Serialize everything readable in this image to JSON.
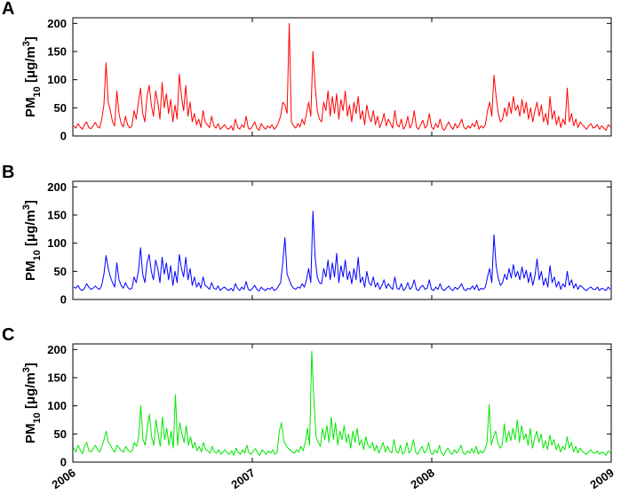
{
  "chart_data": [
    {
      "type": "line",
      "panel": "A",
      "color": "#ff0000",
      "ylabel": {
        "base": "PM",
        "sub": "10",
        "unit_pre": " [μg/m",
        "unit_sup": "3",
        "unit_post": "]"
      },
      "ylim": [
        0,
        210
      ],
      "yticks": [
        0,
        50,
        100,
        150,
        200
      ],
      "xlim": [
        "2006-01-01",
        "2009-01-01"
      ],
      "series": [
        {
          "values": [
            18,
            14,
            22,
            16,
            12,
            20,
            25,
            15,
            13,
            18,
            24,
            17,
            14,
            30,
            55,
            130,
            60,
            45,
            25,
            18,
            80,
            40,
            22,
            16,
            35,
            20,
            14,
            18,
            45,
            30,
            60,
            85,
            40,
            25,
            70,
            90,
            55,
            35,
            80,
            60,
            30,
            95,
            50,
            75,
            40,
            65,
            25,
            55,
            30,
            110,
            70,
            45,
            90,
            35,
            60,
            25,
            40,
            20,
            30,
            15,
            45,
            25,
            20,
            15,
            35,
            18,
            14,
            22,
            12,
            16,
            20,
            14,
            12,
            18,
            10,
            30,
            16,
            12,
            20,
            15,
            35,
            14,
            12,
            18,
            25,
            14,
            10,
            22,
            16,
            12,
            18,
            14,
            20,
            12,
            16,
            24,
            35,
            60,
            55,
            40,
            200,
            25,
            18,
            14,
            22,
            16,
            30,
            20,
            40,
            60,
            35,
            150,
            90,
            45,
            30,
            25,
            60,
            45,
            80,
            35,
            70,
            40,
            75,
            30,
            65,
            45,
            80,
            35,
            55,
            25,
            60,
            40,
            70,
            30,
            45,
            20,
            55,
            35,
            25,
            45,
            20,
            35,
            15,
            25,
            40,
            18,
            30,
            22,
            14,
            45,
            20,
            16,
            30,
            12,
            18,
            35,
            14,
            22,
            45,
            16,
            12,
            20,
            28,
            14,
            18,
            40,
            16,
            12,
            22,
            15,
            30,
            14,
            10,
            18,
            25,
            16,
            12,
            22,
            14,
            20,
            30,
            16,
            12,
            18,
            14,
            22,
            16,
            28,
            12,
            18,
            14,
            20,
            45,
            60,
            35,
            108,
            70,
            40,
            25,
            30,
            50,
            35,
            60,
            40,
            70,
            45,
            55,
            35,
            65,
            40,
            60,
            30,
            50,
            25,
            45,
            60,
            35,
            55,
            25,
            40,
            20,
            70,
            30,
            45,
            20,
            35,
            15,
            30,
            20,
            85,
            25,
            40,
            18,
            30,
            15,
            25,
            20,
            16,
            12,
            18,
            22,
            14,
            16,
            20,
            12,
            18,
            14,
            10,
            20,
            16
          ]
        }
      ]
    },
    {
      "type": "line",
      "panel": "B",
      "color": "#0000ff",
      "ylabel": {
        "base": "PM",
        "sub": "10",
        "unit_pre": " [μg/m",
        "unit_sup": "3",
        "unit_post": "]"
      },
      "ylim": [
        0,
        210
      ],
      "yticks": [
        0,
        50,
        100,
        150,
        200
      ],
      "xlim": [
        "2006-01-01",
        "2009-01-01"
      ],
      "series": [
        {
          "values": [
            22,
            20,
            25,
            18,
            16,
            20,
            28,
            22,
            18,
            20,
            24,
            20,
            18,
            25,
            45,
            78,
            55,
            40,
            30,
            22,
            65,
            35,
            25,
            20,
            30,
            22,
            18,
            20,
            40,
            30,
            50,
            92,
            45,
            30,
            65,
            80,
            50,
            35,
            70,
            55,
            30,
            75,
            45,
            65,
            35,
            60,
            25,
            50,
            30,
            80,
            55,
            40,
            75,
            35,
            55,
            25,
            40,
            22,
            30,
            20,
            40,
            25,
            22,
            18,
            30,
            20,
            18,
            24,
            16,
            20,
            22,
            18,
            16,
            20,
            15,
            28,
            20,
            16,
            22,
            18,
            32,
            18,
            16,
            20,
            25,
            18,
            15,
            22,
            18,
            16,
            20,
            18,
            22,
            16,
            18,
            24,
            30,
            65,
            110,
            45,
            35,
            25,
            20,
            18,
            22,
            20,
            28,
            22,
            35,
            55,
            30,
            157,
            75,
            40,
            30,
            28,
            55,
            40,
            70,
            35,
            65,
            40,
            82,
            30,
            60,
            40,
            70,
            35,
            50,
            28,
            55,
            35,
            75,
            30,
            40,
            22,
            50,
            30,
            25,
            40,
            22,
            30,
            18,
            25,
            35,
            20,
            28,
            22,
            18,
            40,
            20,
            18,
            28,
            16,
            20,
            30,
            18,
            22,
            35,
            18,
            16,
            22,
            25,
            18,
            20,
            35,
            18,
            16,
            22,
            18,
            28,
            18,
            16,
            20,
            24,
            18,
            16,
            22,
            18,
            22,
            28,
            18,
            16,
            20,
            18,
            24,
            18,
            26,
            16,
            20,
            18,
            22,
            40,
            55,
            30,
            115,
            60,
            38,
            25,
            30,
            45,
            35,
            55,
            38,
            62,
            40,
            50,
            35,
            58,
            38,
            52,
            30,
            48,
            25,
            42,
            72,
            35,
            50,
            25,
            38,
            22,
            60,
            30,
            40,
            22,
            32,
            18,
            28,
            22,
            50,
            25,
            35,
            20,
            28,
            18,
            25,
            22,
            18,
            16,
            20,
            22,
            18,
            18,
            22,
            16,
            20,
            18,
            16,
            22,
            18
          ]
        }
      ]
    },
    {
      "type": "line",
      "panel": "C",
      "color": "#00e600",
      "ylabel": {
        "base": "PM",
        "sub": "10",
        "unit_pre": " [μg/m",
        "unit_sup": "3",
        "unit_post": "]"
      },
      "ylim": [
        0,
        210
      ],
      "yticks": [
        0,
        50,
        100,
        150,
        200
      ],
      "xlim": [
        "2006-01-01",
        "2009-01-01"
      ],
      "xticks": [
        "2006",
        "2007",
        "2008",
        "2009"
      ],
      "series": [
        {
          "values": [
            25,
            18,
            30,
            22,
            15,
            28,
            35,
            20,
            18,
            24,
            30,
            22,
            18,
            28,
            40,
            55,
            35,
            30,
            22,
            18,
            30,
            25,
            20,
            18,
            28,
            22,
            18,
            20,
            35,
            28,
            45,
            100,
            40,
            30,
            60,
            85,
            45,
            30,
            75,
            50,
            28,
            80,
            40,
            60,
            30,
            55,
            25,
            120,
            30,
            70,
            50,
            35,
            65,
            30,
            45,
            25,
            35,
            20,
            28,
            18,
            35,
            22,
            20,
            16,
            28,
            18,
            16,
            22,
            14,
            18,
            22,
            16,
            14,
            20,
            12,
            25,
            18,
            14,
            22,
            16,
            30,
            16,
            14,
            20,
            24,
            16,
            12,
            22,
            18,
            14,
            20,
            16,
            22,
            14,
            18,
            55,
            70,
            40,
            30,
            25,
            22,
            18,
            16,
            22,
            18,
            28,
            20,
            35,
            60,
            30,
            197,
            110,
            45,
            35,
            28,
            60,
            40,
            65,
            35,
            80,
            40,
            70,
            30,
            55,
            40,
            65,
            35,
            50,
            25,
            55,
            35,
            60,
            30,
            40,
            22,
            45,
            30,
            25,
            35,
            20,
            30,
            16,
            25,
            35,
            18,
            28,
            20,
            16,
            40,
            20,
            16,
            30,
            14,
            18,
            35,
            16,
            22,
            40,
            18,
            14,
            22,
            28,
            16,
            20,
            35,
            16,
            14,
            22,
            16,
            30,
            16,
            12,
            20,
            25,
            16,
            14,
            22,
            16,
            22,
            30,
            16,
            14,
            20,
            16,
            24,
            16,
            28,
            14,
            20,
            16,
            22,
            35,
            102,
            30,
            45,
            55,
            35,
            25,
            30,
            68,
            35,
            55,
            38,
            60,
            40,
            75,
            35,
            65,
            40,
            50,
            30,
            60,
            25,
            42,
            55,
            35,
            50,
            25,
            38,
            22,
            48,
            30,
            40,
            22,
            32,
            18,
            28,
            22,
            45,
            25,
            35,
            18,
            28,
            16,
            25,
            20,
            16,
            14,
            18,
            22,
            16,
            16,
            20,
            14,
            18,
            16,
            12,
            20,
            16
          ]
        }
      ]
    }
  ]
}
